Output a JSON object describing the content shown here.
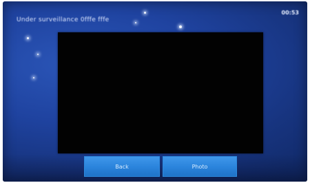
{
  "screen": {
    "title": "Under surveillance 0fffe fffe",
    "clock": "00:53"
  },
  "video": {
    "background": "#020202"
  },
  "buttons": {
    "back_label": "Back",
    "photo_label": "Photo"
  },
  "colors": {
    "background": "#1f43a0",
    "button": "#2a83db"
  }
}
